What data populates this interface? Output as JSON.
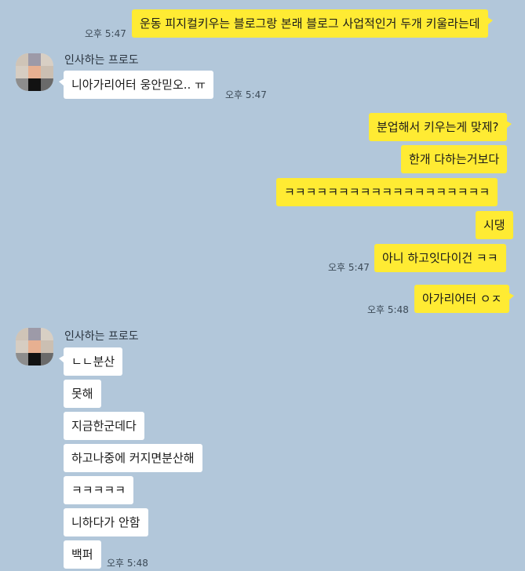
{
  "chat": {
    "sender_name": "인사하는 프로도",
    "messages_1": [
      {
        "text": "운동 피지컬키우는 블로그랑 본래 블로그 사업적인거 두개 키울라는데",
        "time": "오후 5:47"
      }
    ],
    "messages_2": [
      {
        "text": "니아가리어터 웅안믿오.. ㅠ",
        "time": "오후 5:47"
      }
    ],
    "messages_3": [
      {
        "text": "분업해서 키우는게 맞제?"
      },
      {
        "text": "한개 다하는거보다"
      },
      {
        "text": "ㅋㅋㅋㅋㅋㅋㅋㅋㅋㅋㅋㅋㅋㅋㅋㅋㅋㅋㅋ"
      },
      {
        "text": "시댕"
      },
      {
        "text": "아니 하고잇다이건 ㅋㅋ",
        "time": "오후 5:47"
      }
    ],
    "messages_4": [
      {
        "text": "아가리어터 ㅇㅈ",
        "time": "오후 5:48"
      }
    ],
    "messages_5": [
      {
        "text": "ㄴㄴ분산"
      },
      {
        "text": "못해"
      },
      {
        "text": "지금한군데다"
      },
      {
        "text": "하고나중에 커지면분산해"
      },
      {
        "text": "ㅋㅋㅋㅋㅋ"
      },
      {
        "text": "니하다가 안함"
      },
      {
        "text": "백퍼",
        "time": "오후 5:48"
      }
    ]
  },
  "colors": {
    "background": "#b2c7da",
    "my_bubble": "#ffeb33",
    "their_bubble": "#ffffff"
  }
}
